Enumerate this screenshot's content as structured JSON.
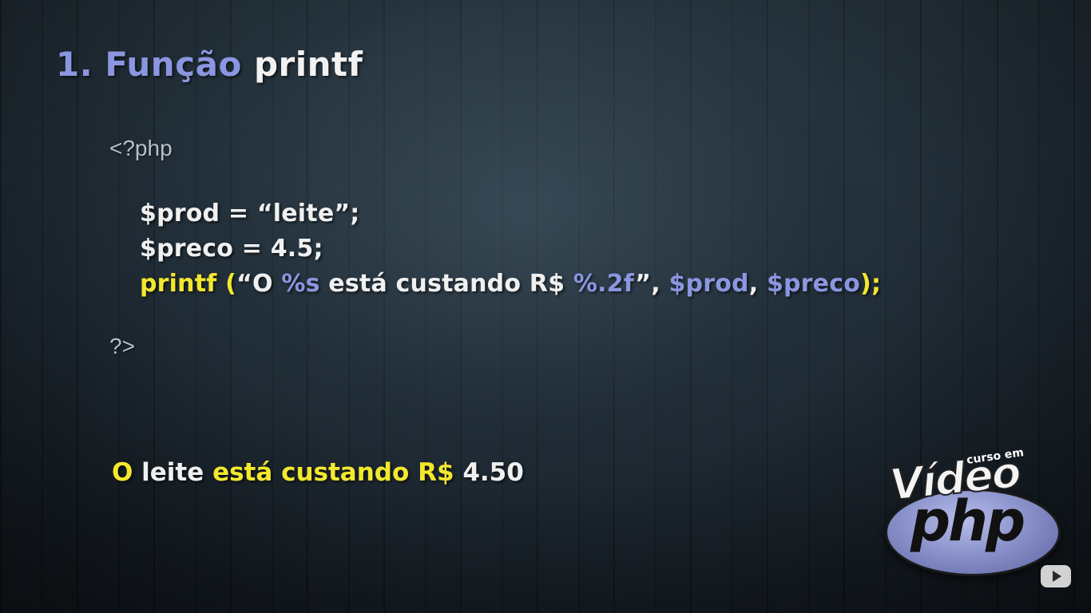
{
  "slide": {
    "title": {
      "number": "1.",
      "word": "Função",
      "function_name": "printf"
    },
    "code": {
      "open_tag": "<?php",
      "close_tag": "?>",
      "line1": "$prod = “leite”;",
      "line2": "$preco = 4.5;",
      "line3": {
        "printf": "printf (",
        "quote_open": "“O ",
        "fmt_s": "%s",
        "middle": " está custando R$ ",
        "fmt_f": "%.2f",
        "quote_close": "”, ",
        "arg1": "$prod",
        "comma": ", ",
        "arg2": "$preco",
        "end": ");"
      }
    },
    "output": {
      "o": "O ",
      "leite": "leite ",
      "middle": "está custando R$ ",
      "value": "4.50"
    }
  },
  "logo": {
    "curso": "curso em",
    "video": "Vídeo",
    "php": "php"
  },
  "icons": {
    "player": "youtube-play-icon"
  },
  "colors": {
    "white": "#f0f0f0",
    "yellow": "#f3e82e",
    "blue": "#8b96e0",
    "gray": "#b8c0c8"
  }
}
